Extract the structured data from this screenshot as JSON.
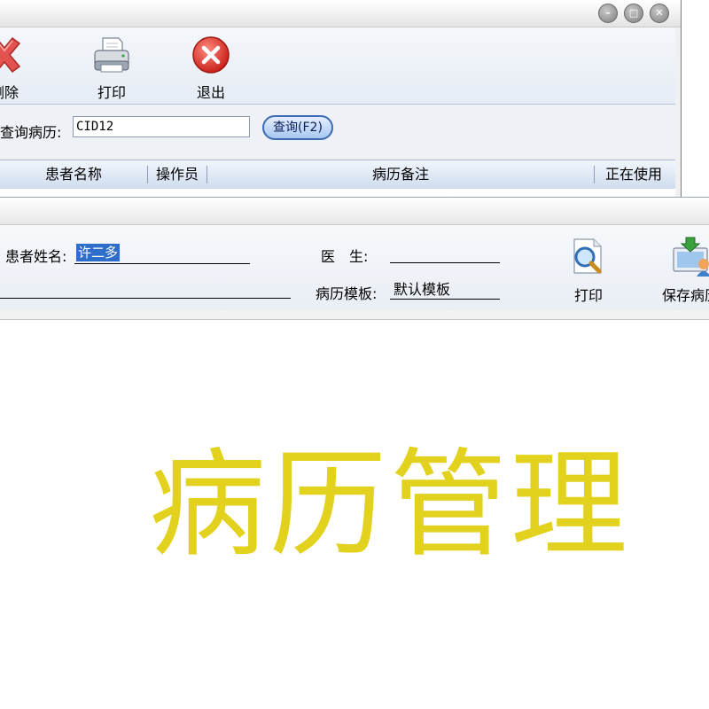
{
  "back_window": {
    "toolbar": {
      "delete_label": "删除",
      "print_label": "打印",
      "exit_label": "退出"
    },
    "query": {
      "label": "查询病历:",
      "value": "CID12",
      "button_label": "查询(F2)"
    },
    "grid": {
      "columns": [
        "患者名称",
        "操作员",
        "病历备注",
        "正在使用"
      ]
    }
  },
  "front_window": {
    "patient_name_label": "患者姓名:",
    "patient_name_value": "许二多",
    "doctor_label": "医　生:",
    "doctor_value": "",
    "template_label": "病历模板:",
    "template_value": "默认模板",
    "print_label": "打印",
    "save_label": "保存病历"
  },
  "caption": "病历管理",
  "colors": {
    "caption": "#e2d21e",
    "selection": "#2c6ec9",
    "query_button_border": "#3d6bb3"
  },
  "icons": [
    "delete-x-icon",
    "printer-icon",
    "exit-icon",
    "print-preview-icon",
    "save-record-icon",
    "minimize-icon",
    "restore-icon",
    "close-icon"
  ]
}
